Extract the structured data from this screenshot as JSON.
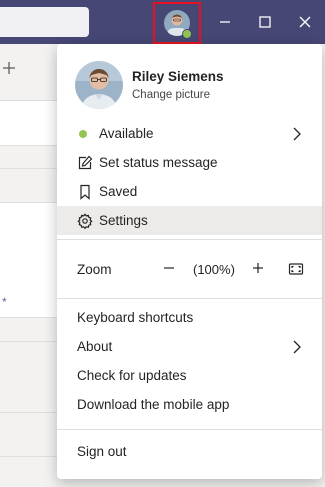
{
  "profile": {
    "name": "Riley Siemens",
    "change_picture": "Change picture"
  },
  "status": {
    "label": "Available",
    "color": "#92c353"
  },
  "menu": {
    "set_status": "Set status message",
    "saved": "Saved",
    "settings": "Settings",
    "zoom_label": "Zoom",
    "zoom_minus": "−",
    "zoom_value": "(100%)",
    "zoom_plus": "+",
    "keyboard_shortcuts": "Keyboard shortcuts",
    "about": "About",
    "check_updates": "Check for updates",
    "download_mobile": "Download the mobile app",
    "sign_out": "Sign out"
  },
  "colors": {
    "titlebar": "#464775",
    "accent": "#6264a7",
    "highlight_border": "#e81123"
  }
}
